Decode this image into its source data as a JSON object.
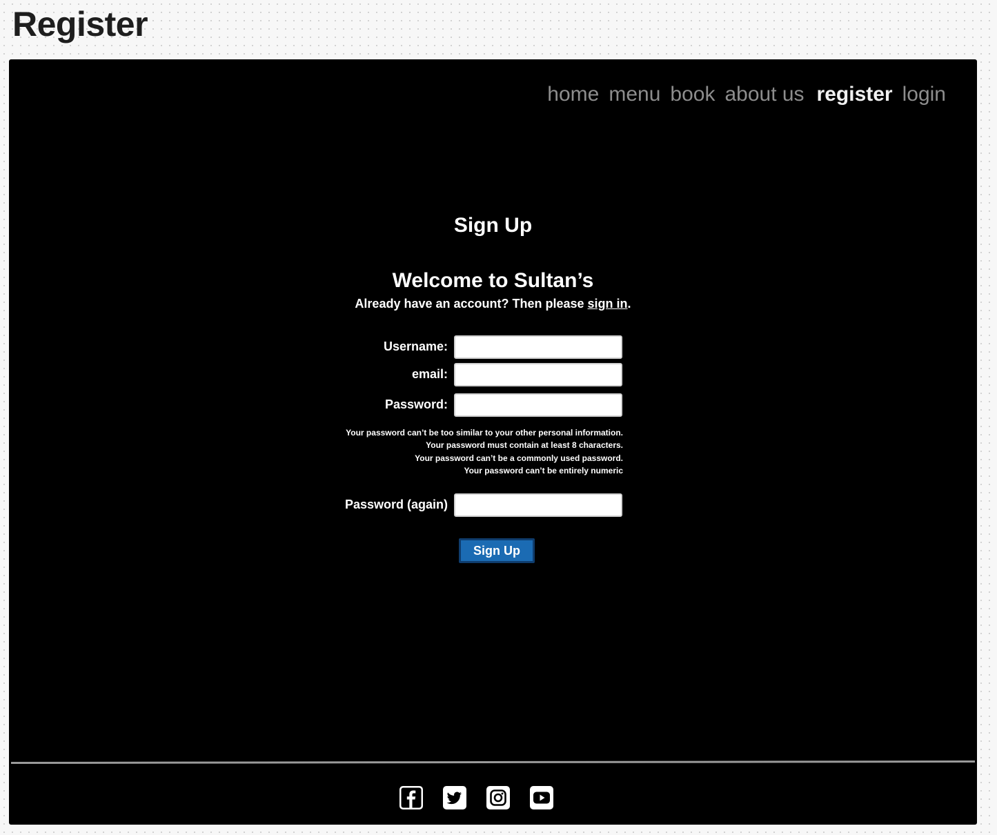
{
  "frame": {
    "title": "Register"
  },
  "nav": {
    "items": [
      {
        "label": "home",
        "active": false
      },
      {
        "label": "menu",
        "active": false
      },
      {
        "label": "book",
        "active": false
      },
      {
        "label": "about us",
        "active": false
      },
      {
        "label": "register",
        "active": true
      },
      {
        "label": "login",
        "active": false
      }
    ]
  },
  "main": {
    "heading": "Sign Up",
    "welcome": "Welcome to Sultan’s",
    "already_text": "Already have an account? Then please ",
    "sign_in_link": "sign in",
    "already_suffix": "."
  },
  "form": {
    "username_label": "Username:",
    "username_value": "",
    "email_label": "email:",
    "email_value": "",
    "password_label": "Password:",
    "password_value": "",
    "password_help": [
      "Your password can’t be too similar to your other personal information.",
      "Your password must contain at least 8 characters.",
      "Your password can’t be a commonly used password.",
      "Your password can’t be entirely numeric"
    ],
    "password2_label": "Password (again)",
    "password2_value": "",
    "submit_label": "Sign Up"
  },
  "footer": {
    "social": [
      "facebook-icon",
      "twitter-icon",
      "instagram-icon",
      "youtube-icon"
    ]
  },
  "colors": {
    "page_bg": "#000000",
    "nav_inactive": "#8d8d8d",
    "nav_active": "#f0f0f0",
    "button_bg": "#1b6bb3",
    "button_border": "#0f3d6e",
    "footer_line": "#9a9a9a"
  }
}
